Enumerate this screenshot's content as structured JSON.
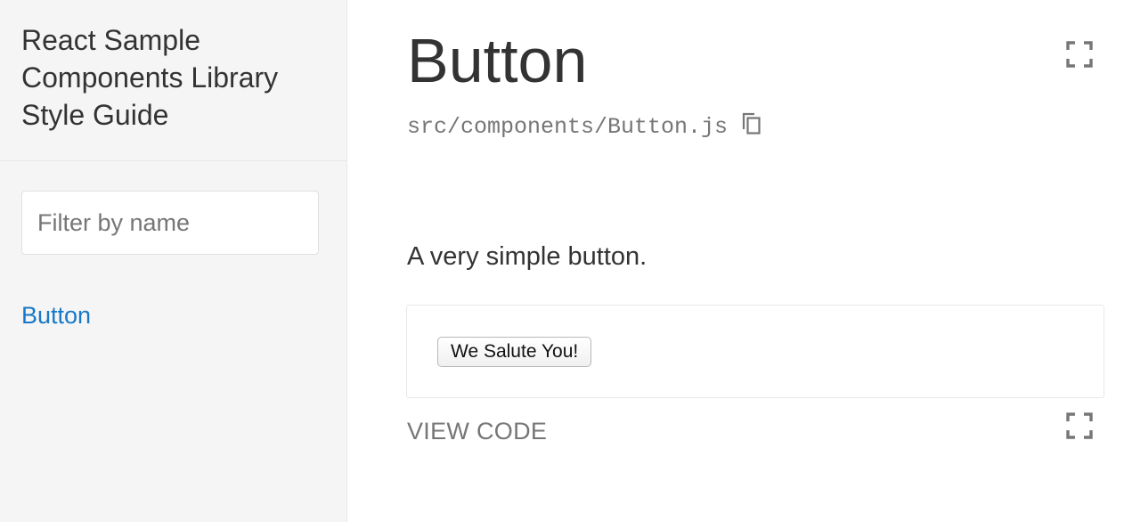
{
  "sidebar": {
    "title": "React Sample Components Library Style Guide",
    "filter": {
      "placeholder": "Filter by name",
      "value": ""
    },
    "items": [
      {
        "label": "Button"
      }
    ]
  },
  "main": {
    "component_name": "Button",
    "file_path": "src/components/Button.js",
    "description": "A very simple button.",
    "example_button_label": "We Salute You!",
    "view_code_label": "VIEW CODE",
    "icons": {
      "fullscreen": "fullscreen-icon",
      "copy": "copy-icon"
    }
  },
  "colors": {
    "sidebar_bg": "#f5f5f5",
    "link": "#1978c8",
    "muted": "#767676",
    "text": "#333333"
  }
}
